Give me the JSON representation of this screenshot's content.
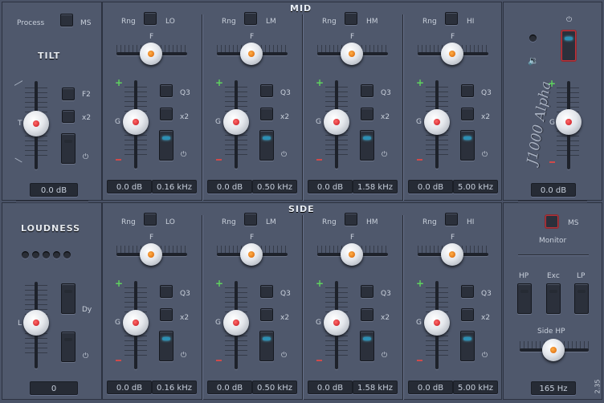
{
  "mid": {
    "title": "MID"
  },
  "side": {
    "title": "SIDE"
  },
  "left_top": {
    "process": "Process",
    "ms": "MS",
    "title": "TILT",
    "f2": "F2",
    "x2": "x2",
    "t": "T",
    "power": "⏻",
    "value": "0.0 dB"
  },
  "left_bottom": {
    "title": "LOUDNESS",
    "l": "L",
    "dy": "Dy",
    "power": "⏻",
    "value": "0"
  },
  "bands_mid": [
    {
      "rng": "Rng",
      "name": "LO",
      "f": "F",
      "g": "G",
      "q": "Q3",
      "x2": "x2",
      "power": "⏻",
      "gain": "0.0 dB",
      "freq": "0.16 kHz"
    },
    {
      "rng": "Rng",
      "name": "LM",
      "f": "F",
      "g": "G",
      "q": "Q3",
      "x2": "x2",
      "power": "⏻",
      "gain": "0.0 dB",
      "freq": "0.50 kHz"
    },
    {
      "rng": "Rng",
      "name": "HM",
      "f": "F",
      "g": "G",
      "q": "Q3",
      "x2": "x2",
      "power": "⏻",
      "gain": "0.0 dB",
      "freq": "1.58 kHz"
    },
    {
      "rng": "Rng",
      "name": "HI",
      "f": "F",
      "g": "G",
      "q": "Q3",
      "x2": "x2",
      "power": "⏻",
      "gain": "0.0 dB",
      "freq": "5.00 kHz"
    }
  ],
  "bands_side": [
    {
      "rng": "Rng",
      "name": "LO",
      "f": "F",
      "g": "G",
      "q": "Q3",
      "x2": "x2",
      "power": "⏻",
      "gain": "0.0 dB",
      "freq": "0.16 kHz"
    },
    {
      "rng": "Rng",
      "name": "LM",
      "f": "F",
      "g": "G",
      "q": "Q3",
      "x2": "x2",
      "power": "⏻",
      "gain": "0.0 dB",
      "freq": "0.50 kHz"
    },
    {
      "rng": "Rng",
      "name": "HM",
      "f": "F",
      "g": "G",
      "q": "Q3",
      "x2": "x2",
      "power": "⏻",
      "gain": "0.0 dB",
      "freq": "1.58 kHz"
    },
    {
      "rng": "Rng",
      "name": "HI",
      "f": "F",
      "g": "G",
      "q": "Q3",
      "x2": "x2",
      "power": "⏻",
      "gain": "0.0 dB",
      "freq": "5.00 kHz"
    }
  ],
  "right": {
    "power": "⏻",
    "brand": "J1000 Alpha",
    "g": "G",
    "value": "0.0 dB",
    "ms": "MS",
    "monitor": "Monitor",
    "hp": "HP",
    "exc": "Exc",
    "lp": "LP",
    "side_hp": "Side HP",
    "side_hp_value": "165 Hz",
    "version": "2.35"
  },
  "colors": {
    "led_on": "#4dd5ff",
    "accent_red": "#c0333b",
    "plus": "#5fd35f",
    "minus": "#d04a4a"
  }
}
